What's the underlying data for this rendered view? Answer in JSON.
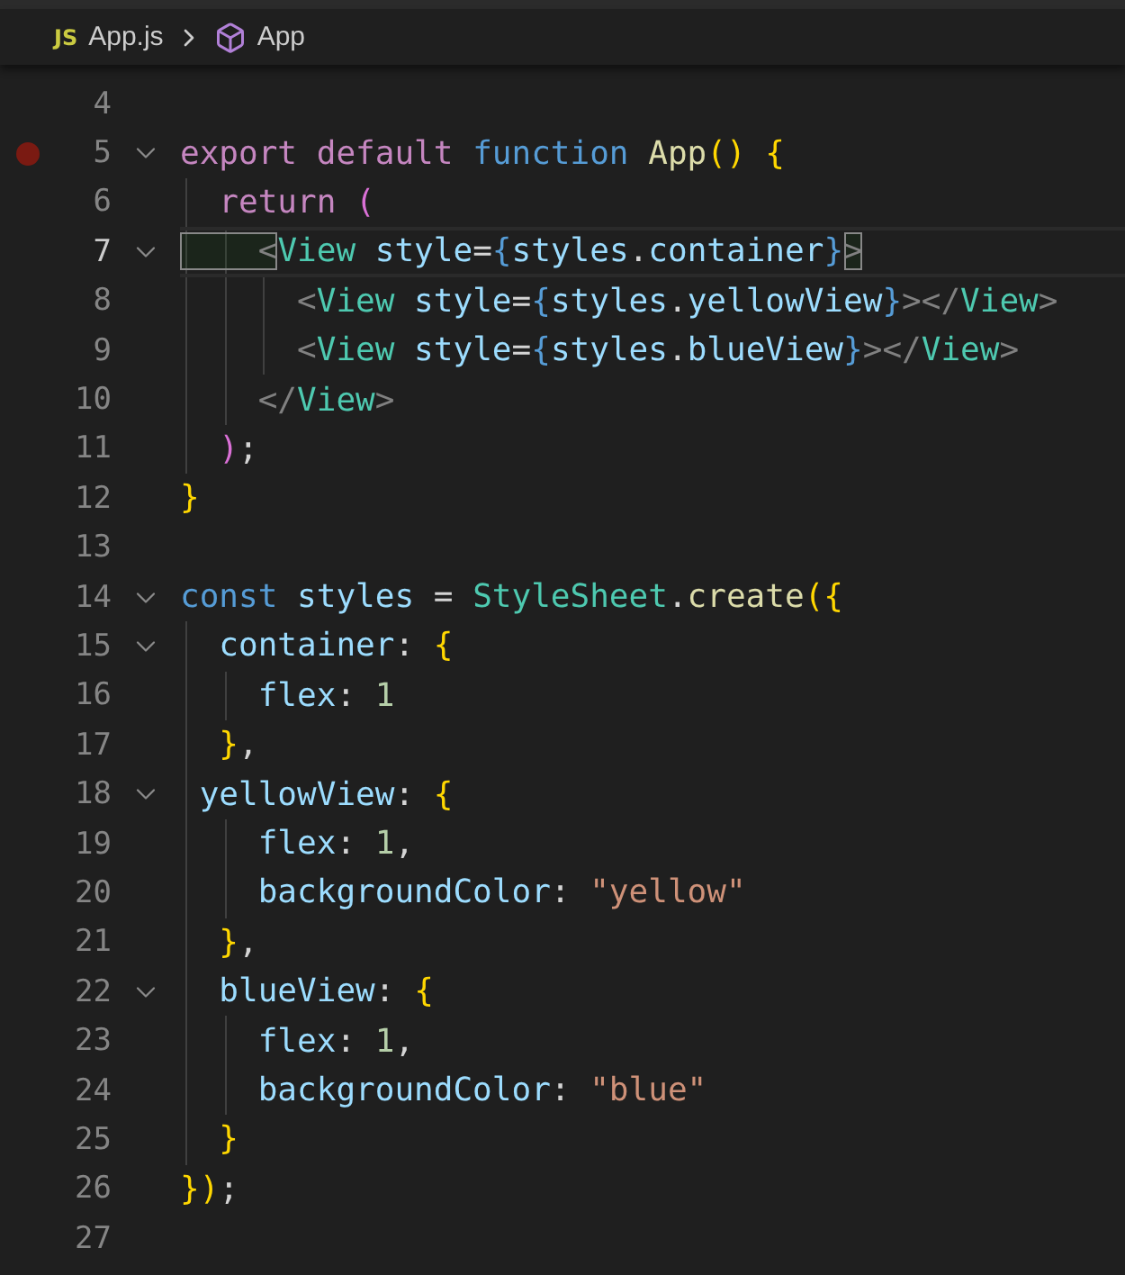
{
  "breadcrumb": {
    "file_badge": "JS",
    "file": "App.js",
    "symbol": "App"
  },
  "lines": [
    {
      "number": "4",
      "fold": false,
      "breakpoint": false,
      "active": false
    },
    {
      "number": "5",
      "fold": true,
      "breakpoint": true,
      "active": false,
      "tokens": [
        {
          "kind": "keyword",
          "text": "export "
        },
        {
          "kind": "keyword",
          "text": "default "
        },
        {
          "kind": "storage",
          "text": "function "
        },
        {
          "kind": "function",
          "text": "App"
        },
        {
          "kind": "bracket",
          "text": "() {"
        }
      ]
    },
    {
      "number": "6",
      "fold": false,
      "breakpoint": false,
      "active": false,
      "tokens": [
        {
          "kind": "keyword",
          "text": "  return "
        },
        {
          "kind": "bracket2",
          "text": "("
        }
      ]
    },
    {
      "number": "7",
      "fold": true,
      "breakpoint": false,
      "active": true,
      "tokens": [
        {
          "kind": "tagpunct",
          "text": "    <",
          "matched": true
        },
        {
          "kind": "type",
          "text": "View"
        },
        {
          "kind": "variable",
          "text": " style"
        },
        {
          "kind": "punct",
          "text": "="
        },
        {
          "kind": "jsxbrace",
          "text": "{"
        },
        {
          "kind": "variable",
          "text": "styles"
        },
        {
          "kind": "punct",
          "text": "."
        },
        {
          "kind": "variable",
          "text": "container"
        },
        {
          "kind": "jsxbrace",
          "text": "}"
        },
        {
          "kind": "tagpunct",
          "text": ">",
          "matched": true
        }
      ]
    },
    {
      "number": "8",
      "fold": false,
      "breakpoint": false,
      "active": false,
      "tokens": [
        {
          "kind": "tagpunct",
          "text": "      <"
        },
        {
          "kind": "type",
          "text": "View"
        },
        {
          "kind": "variable",
          "text": " style"
        },
        {
          "kind": "punct",
          "text": "="
        },
        {
          "kind": "jsxbrace",
          "text": "{"
        },
        {
          "kind": "variable",
          "text": "styles"
        },
        {
          "kind": "punct",
          "text": "."
        },
        {
          "kind": "variable",
          "text": "yellowView"
        },
        {
          "kind": "jsxbrace",
          "text": "}"
        },
        {
          "kind": "tagpunct",
          "text": "></"
        },
        {
          "kind": "type",
          "text": "View"
        },
        {
          "kind": "tagpunct",
          "text": ">"
        }
      ]
    },
    {
      "number": "9",
      "fold": false,
      "breakpoint": false,
      "active": false,
      "tokens": [
        {
          "kind": "tagpunct",
          "text": "      <"
        },
        {
          "kind": "type",
          "text": "View"
        },
        {
          "kind": "variable",
          "text": " style"
        },
        {
          "kind": "punct",
          "text": "="
        },
        {
          "kind": "jsxbrace",
          "text": "{"
        },
        {
          "kind": "variable",
          "text": "styles"
        },
        {
          "kind": "punct",
          "text": "."
        },
        {
          "kind": "variable",
          "text": "blueView"
        },
        {
          "kind": "jsxbrace",
          "text": "}"
        },
        {
          "kind": "tagpunct",
          "text": "></"
        },
        {
          "kind": "type",
          "text": "View"
        },
        {
          "kind": "tagpunct",
          "text": ">"
        }
      ]
    },
    {
      "number": "10",
      "fold": false,
      "breakpoint": false,
      "active": false,
      "tokens": [
        {
          "kind": "tagpunct",
          "text": "    </"
        },
        {
          "kind": "type",
          "text": "View"
        },
        {
          "kind": "tagpunct",
          "text": ">"
        }
      ]
    },
    {
      "number": "11",
      "fold": false,
      "breakpoint": false,
      "active": false,
      "tokens": [
        {
          "kind": "bracket2",
          "text": "  )"
        },
        {
          "kind": "punct",
          "text": ";"
        }
      ]
    },
    {
      "number": "12",
      "fold": false,
      "breakpoint": false,
      "active": false,
      "tokens": [
        {
          "kind": "bracket",
          "text": "}"
        }
      ]
    },
    {
      "number": "13",
      "fold": false,
      "breakpoint": false,
      "active": false
    },
    {
      "number": "14",
      "fold": true,
      "breakpoint": false,
      "active": false,
      "tokens": [
        {
          "kind": "storage",
          "text": "const "
        },
        {
          "kind": "variable",
          "text": "styles"
        },
        {
          "kind": "punct",
          "text": " = "
        },
        {
          "kind": "type",
          "text": "StyleSheet"
        },
        {
          "kind": "punct",
          "text": "."
        },
        {
          "kind": "function",
          "text": "create"
        },
        {
          "kind": "bracket",
          "text": "({"
        }
      ]
    },
    {
      "number": "15",
      "fold": true,
      "breakpoint": false,
      "active": false,
      "tokens": [
        {
          "kind": "variable",
          "text": "  container"
        },
        {
          "kind": "punct",
          "text": ": "
        },
        {
          "kind": "bracket",
          "text": "{"
        }
      ]
    },
    {
      "number": "16",
      "fold": false,
      "breakpoint": false,
      "active": false,
      "tokens": [
        {
          "kind": "variable",
          "text": "    flex"
        },
        {
          "kind": "punct",
          "text": ": "
        },
        {
          "kind": "number",
          "text": "1"
        }
      ]
    },
    {
      "number": "17",
      "fold": false,
      "breakpoint": false,
      "active": false,
      "tokens": [
        {
          "kind": "bracket",
          "text": "  }"
        },
        {
          "kind": "punct",
          "text": ","
        }
      ]
    },
    {
      "number": "18",
      "fold": true,
      "breakpoint": false,
      "active": false,
      "tokens": [
        {
          "kind": "variable",
          "text": " yellowView"
        },
        {
          "kind": "punct",
          "text": ": "
        },
        {
          "kind": "bracket",
          "text": "{"
        }
      ]
    },
    {
      "number": "19",
      "fold": false,
      "breakpoint": false,
      "active": false,
      "tokens": [
        {
          "kind": "variable",
          "text": "    flex"
        },
        {
          "kind": "punct",
          "text": ": "
        },
        {
          "kind": "number",
          "text": "1"
        },
        {
          "kind": "punct",
          "text": ","
        }
      ]
    },
    {
      "number": "20",
      "fold": false,
      "breakpoint": false,
      "active": false,
      "tokens": [
        {
          "kind": "variable",
          "text": "    backgroundColor"
        },
        {
          "kind": "punct",
          "text": ": "
        },
        {
          "kind": "string",
          "text": "\"yellow\""
        }
      ]
    },
    {
      "number": "21",
      "fold": false,
      "breakpoint": false,
      "active": false,
      "tokens": [
        {
          "kind": "bracket",
          "text": "  }"
        },
        {
          "kind": "punct",
          "text": ","
        }
      ]
    },
    {
      "number": "22",
      "fold": true,
      "breakpoint": false,
      "active": false,
      "tokens": [
        {
          "kind": "variable",
          "text": "  blueView"
        },
        {
          "kind": "punct",
          "text": ": "
        },
        {
          "kind": "bracket",
          "text": "{"
        }
      ]
    },
    {
      "number": "23",
      "fold": false,
      "breakpoint": false,
      "active": false,
      "tokens": [
        {
          "kind": "variable",
          "text": "    flex"
        },
        {
          "kind": "punct",
          "text": ": "
        },
        {
          "kind": "number",
          "text": "1"
        },
        {
          "kind": "punct",
          "text": ","
        }
      ]
    },
    {
      "number": "24",
      "fold": false,
      "breakpoint": false,
      "active": false,
      "tokens": [
        {
          "kind": "variable",
          "text": "    backgroundColor"
        },
        {
          "kind": "punct",
          "text": ": "
        },
        {
          "kind": "string",
          "text": "\"blue\""
        }
      ]
    },
    {
      "number": "25",
      "fold": false,
      "breakpoint": false,
      "active": false,
      "tokens": [
        {
          "kind": "bracket",
          "text": "  }"
        }
      ]
    },
    {
      "number": "26",
      "fold": false,
      "breakpoint": false,
      "active": false,
      "tokens": [
        {
          "kind": "bracket",
          "text": "}"
        },
        {
          "kind": "bracket",
          "text": ")"
        },
        {
          "kind": "punct",
          "text": ";"
        }
      ]
    },
    {
      "number": "27",
      "fold": false,
      "breakpoint": false,
      "active": false
    }
  ]
}
